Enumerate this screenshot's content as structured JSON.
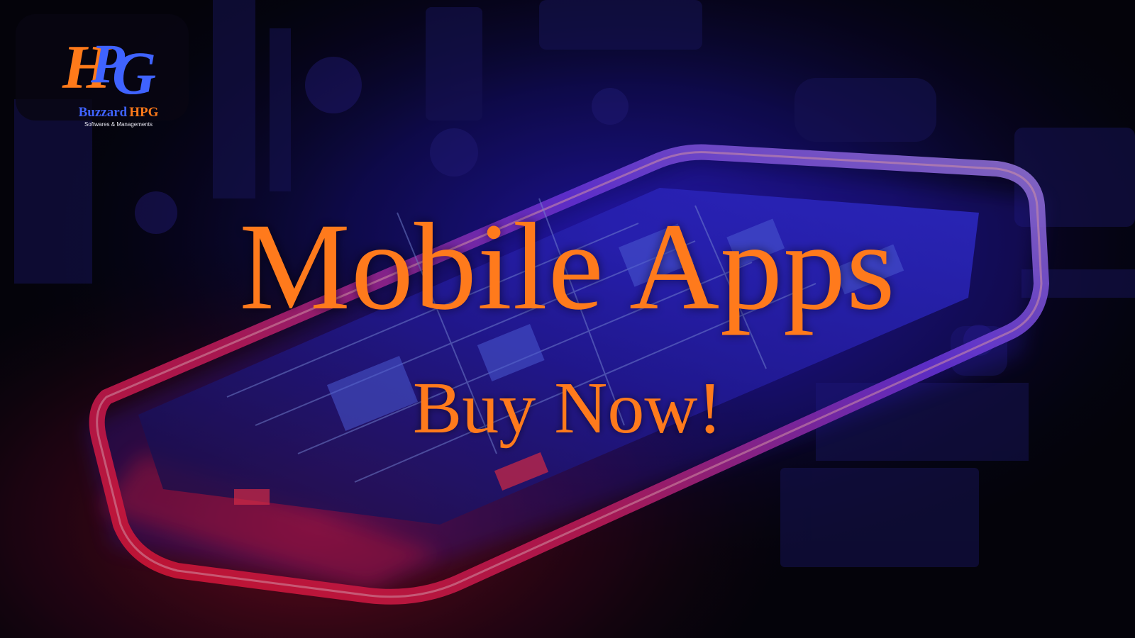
{
  "brand": {
    "monogram": "HPG",
    "name_part_1": "Buzzard",
    "name_part_2": "HPG",
    "tagline": "Softwares & Managements"
  },
  "hero": {
    "headline": "Mobile Apps",
    "cta": "Buy Now!"
  },
  "colors": {
    "accent_orange": "#ff7a1c",
    "brand_blue": "#3f63ff",
    "background": "#05040d",
    "glow_blue": "#3a22ff",
    "glow_red": "#ff1a3c"
  },
  "background_image": "smartphone-with-circuit-board-under-neon-light-icon"
}
